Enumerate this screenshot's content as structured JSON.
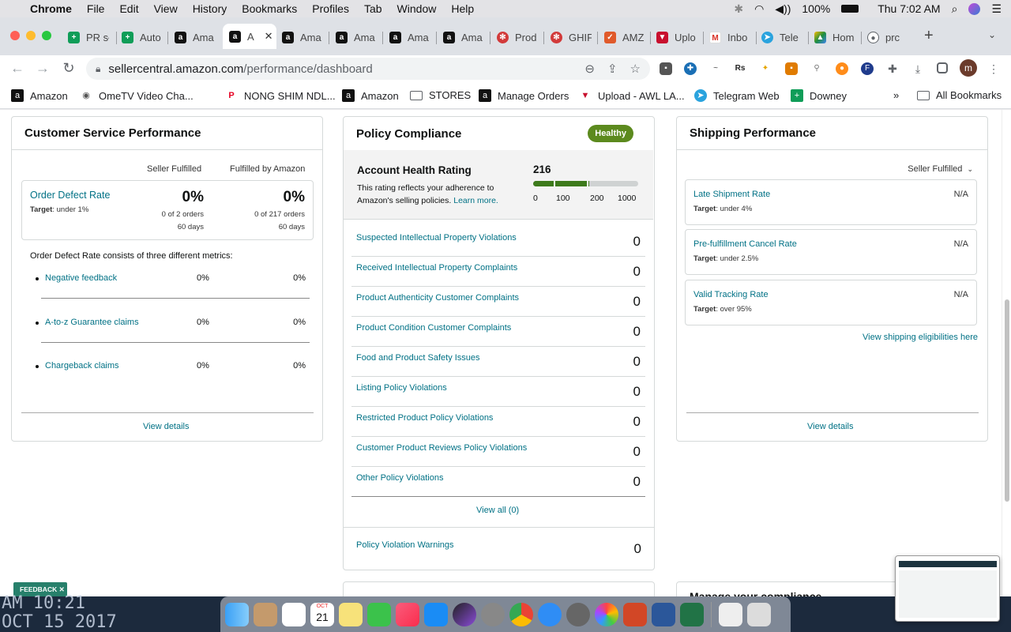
{
  "menubar": {
    "app": "Chrome",
    "items": [
      "File",
      "Edit",
      "View",
      "History",
      "Bookmarks",
      "Profiles",
      "Tab",
      "Window",
      "Help"
    ],
    "battery": "100%",
    "clock": "Thu 7:02 AM"
  },
  "tabs": [
    {
      "label": "PR sł",
      "color": "#0f9d58"
    },
    {
      "label": "Auto",
      "color": "#0f9d58"
    },
    {
      "label": "Ama",
      "color": "#111"
    },
    {
      "label": "A",
      "color": "#111",
      "active": true
    },
    {
      "label": "Ama",
      "color": "#111"
    },
    {
      "label": "Ama",
      "color": "#111"
    },
    {
      "label": "Ama",
      "color": "#111"
    },
    {
      "label": "Ama",
      "color": "#111"
    },
    {
      "label": "Prod",
      "color": "#d23a3a"
    },
    {
      "label": "GHIF",
      "color": "#d23a3a"
    },
    {
      "label": "AMZ",
      "color": "#e05a2b"
    },
    {
      "label": "Uplo",
      "color": "#c8102e"
    },
    {
      "label": "Inbo",
      "color": "#d93025"
    },
    {
      "label": "Tele",
      "color": "#2aa3de"
    },
    {
      "label": "Hom",
      "color": "#1e8e3e"
    },
    {
      "label": "prc",
      "color": "#5f6368"
    }
  ],
  "address": {
    "host": "sellercentral.amazon.com",
    "path": "/performance/dashboard"
  },
  "profile_initial": "m",
  "bookmarks": [
    {
      "label": "Amazon",
      "icon": "a"
    },
    {
      "label": "OmeTV Video Cha...",
      "icon": "tv"
    },
    {
      "label": "NONG SHIM NDL...",
      "icon": "p"
    },
    {
      "label": "Amazon",
      "icon": "a"
    },
    {
      "label": "STORES",
      "icon": "folder"
    },
    {
      "label": "Manage Orders",
      "icon": "a"
    },
    {
      "label": "Upload - AWL LA...",
      "icon": "v"
    },
    {
      "label": "Telegram Web",
      "icon": "tg"
    },
    {
      "label": "Downey",
      "icon": "g"
    }
  ],
  "all_bookmarks": "All Bookmarks",
  "customer_service": {
    "title": "Customer Service Performance",
    "col_seller": "Seller Fulfilled",
    "col_fba": "Fulfilled by Amazon",
    "odr_label": "Order Defect Rate",
    "odr_target_label": "Target",
    "odr_target": ": under 1%",
    "seller_pct": "0%",
    "seller_orders": "0 of 2 orders",
    "seller_days": "60 days",
    "fba_pct": "0%",
    "fba_orders": "0 of 217 orders",
    "fba_days": "60 days",
    "consists": "Order Defect Rate consists of three different metrics:",
    "metrics": [
      {
        "label": "Negative feedback",
        "seller": "0%",
        "fba": "0%"
      },
      {
        "label": "A-to-z Guarantee claims",
        "seller": "0%",
        "fba": "0%"
      },
      {
        "label": "Chargeback claims",
        "seller": "0%",
        "fba": "0%"
      }
    ],
    "view_details": "View details"
  },
  "policy": {
    "title": "Policy Compliance",
    "badge": "Healthy",
    "ahr_title": "Account Health Rating",
    "ahr_desc": "This rating reflects your adherence to Amazon's selling policies.",
    "learn_more": "Learn more.",
    "score": "216",
    "score_fraction": 0.216,
    "scale": [
      "0",
      "100",
      "200",
      "1000"
    ],
    "rows": [
      {
        "label": "Suspected Intellectual Property Violations",
        "value": "0"
      },
      {
        "label": "Received Intellectual Property Complaints",
        "value": "0"
      },
      {
        "label": "Product Authenticity Customer Complaints",
        "value": "0"
      },
      {
        "label": "Product Condition Customer Complaints",
        "value": "0"
      },
      {
        "label": "Food and Product Safety Issues",
        "value": "0"
      },
      {
        "label": "Listing Policy Violations",
        "value": "0"
      },
      {
        "label": "Restricted Product Policy Violations",
        "value": "0"
      },
      {
        "label": "Customer Product Reviews Policy Violations",
        "value": "0"
      },
      {
        "label": "Other Policy Violations",
        "value": "0"
      }
    ],
    "view_all": "View all (0)",
    "warnings_label": "Policy Violation Warnings",
    "warnings_value": "0"
  },
  "shipping": {
    "title": "Shipping Performance",
    "filter": "Seller Fulfilled",
    "rows": [
      {
        "label": "Late Shipment Rate",
        "target_label": "Target",
        "target": ": under 4%",
        "value": "N/A"
      },
      {
        "label": "Pre-fulfillment Cancel Rate",
        "target_label": "Target",
        "target": ": under 2.5%",
        "value": "N/A"
      },
      {
        "label": "Valid Tracking Rate",
        "target_label": "Target",
        "target": ": over 95%",
        "value": "N/A"
      }
    ],
    "eligibilities": "View shipping eligibilities here",
    "view_details": "View details",
    "next_card_peek": "Manage your compliance"
  },
  "feedback": "FEEDBACK",
  "desktop_clock": {
    "line1": "AM 10:21",
    "line2": "OCT 15 2017"
  },
  "dock_calendar": {
    "month": "OCT",
    "day": "21"
  },
  "colors": {
    "link": "#007185",
    "healthy": "#5c8a1e",
    "border": "#d5d9d9"
  }
}
